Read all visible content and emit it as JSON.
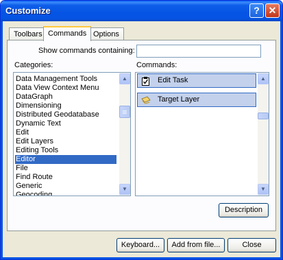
{
  "window": {
    "title": "Customize",
    "help_glyph": "?",
    "close_glyph": "✕"
  },
  "tabs": [
    {
      "label": "Toolbars",
      "active": false
    },
    {
      "label": "Commands",
      "active": true
    },
    {
      "label": "Options",
      "active": false
    }
  ],
  "search": {
    "label": "Show commands containing:",
    "value": ""
  },
  "categories": {
    "label": "Categories:",
    "items": [
      "Data Management Tools",
      "Data View Context Menu",
      "DataGraph",
      "Dimensioning",
      "Distributed Geodatabase",
      "Dynamic Text",
      "Edit",
      "Edit Layers",
      "Editing Tools",
      "Editor",
      "File",
      "Find Route",
      "Generic",
      "Geocoding"
    ],
    "selected": "Editor"
  },
  "commands": {
    "label": "Commands:",
    "items": [
      {
        "label": "Edit Task",
        "icon": "edit-task-icon"
      },
      {
        "label": "Target Layer",
        "icon": "target-layer-icon"
      }
    ]
  },
  "buttons": {
    "description": "Description",
    "keyboard": "Keyboard...",
    "add_from_file": "Add from file...",
    "close": "Close"
  },
  "scroll_arrows": {
    "up": "▲",
    "down": "▼"
  },
  "colors": {
    "titlebar": "#0554e3",
    "selection": "#316ac5",
    "command_highlight": "#c3d1ec",
    "dialog_face": "#ece9d8"
  }
}
